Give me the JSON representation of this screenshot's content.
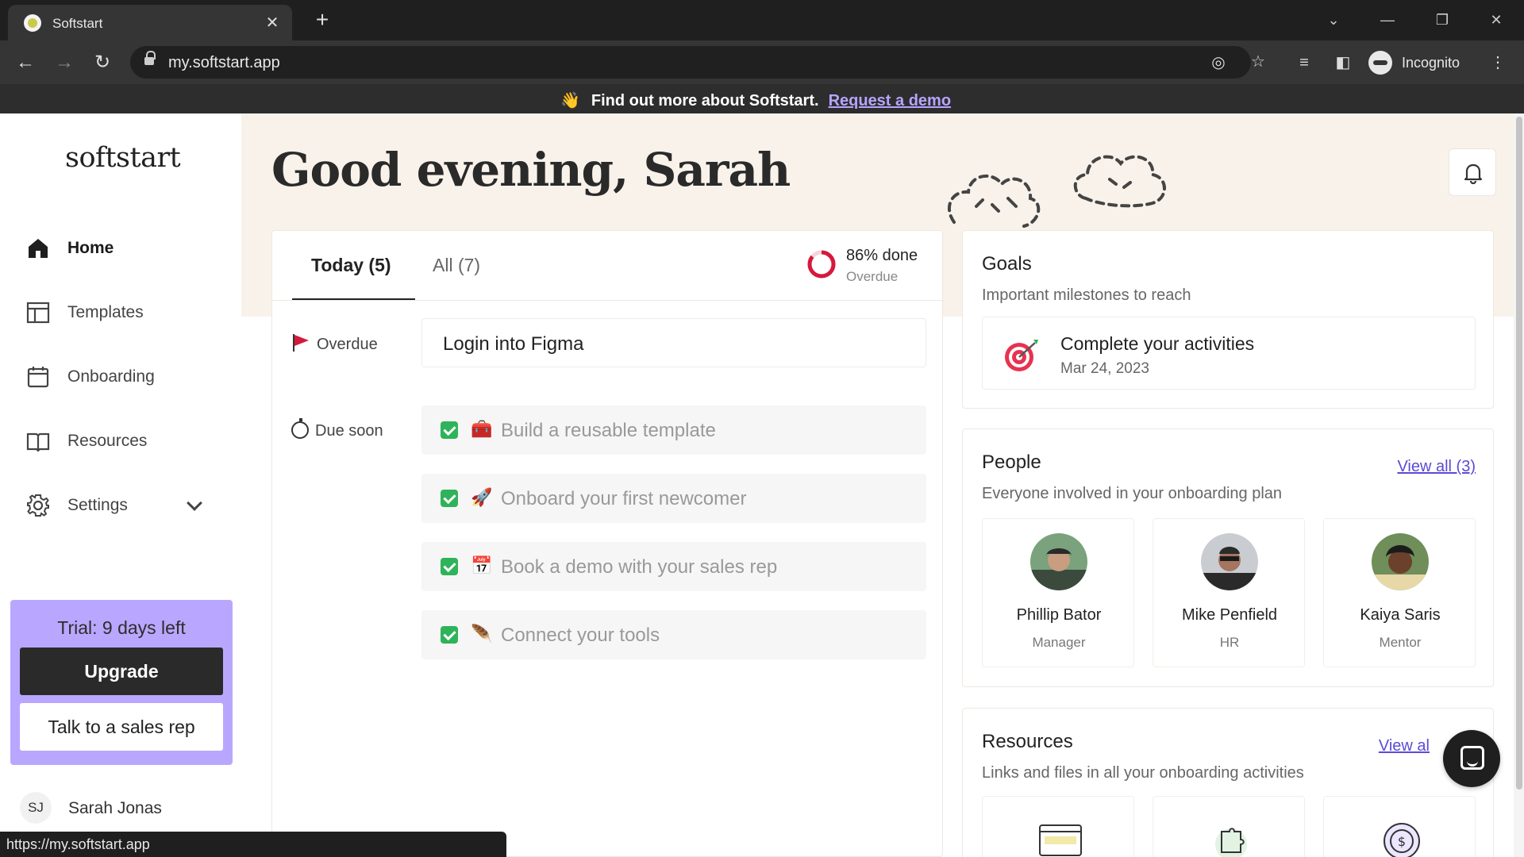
{
  "browser": {
    "tab_title": "Softstart",
    "url": "my.softstart.app",
    "profile_label": "Incognito",
    "status_url": "https://my.softstart.app"
  },
  "banner": {
    "emoji": "👋",
    "text": "Find out more about Softstart.",
    "link": "Request a demo"
  },
  "sidebar": {
    "logo": "softstart",
    "items": [
      {
        "label": "Home",
        "icon": "home-icon",
        "active": true
      },
      {
        "label": "Templates",
        "icon": "templates-icon"
      },
      {
        "label": "Onboarding",
        "icon": "calendar-icon"
      },
      {
        "label": "Resources",
        "icon": "book-icon"
      },
      {
        "label": "Settings",
        "icon": "gear-icon"
      }
    ],
    "trial": {
      "text": "Trial: 9 days left",
      "upgrade_label": "Upgrade",
      "sales_label": "Talk to a sales rep"
    },
    "user": {
      "initials": "SJ",
      "name": "Sarah Jonas"
    }
  },
  "main": {
    "greeting": "Good evening, Sarah",
    "tasks": {
      "tab_today": "Today (5)",
      "tab_all": "All (7)",
      "progress_text": "86% done",
      "progress_value": 0.86,
      "progress_sub": "Overdue",
      "overdue_label": "Overdue",
      "due_soon_label": "Due soon",
      "overdue_items": [
        {
          "title": "Login into Figma"
        }
      ],
      "due_soon_items": [
        {
          "emoji": "🧰",
          "title": "Build a reusable template",
          "done": true
        },
        {
          "emoji": "🚀",
          "title": "Onboard your first newcomer",
          "done": true
        },
        {
          "emoji": "📅",
          "title": "Book a demo with your sales rep",
          "done": true
        },
        {
          "emoji": "🪶",
          "title": "Connect your tools",
          "done": true
        }
      ]
    },
    "goals": {
      "title": "Goals",
      "subtitle": "Important milestones to reach",
      "items": [
        {
          "title": "Complete your activities",
          "date": "Mar 24, 2023",
          "icon": "target-icon"
        }
      ]
    },
    "people": {
      "title": "People",
      "subtitle": "Everyone involved in your onboarding plan",
      "view_all": "View all (3)",
      "items": [
        {
          "name": "Phillip Bator",
          "role": "Manager"
        },
        {
          "name": "Mike Penfield",
          "role": "HR"
        },
        {
          "name": "Kaiya Saris",
          "role": "Mentor"
        }
      ]
    },
    "resources": {
      "title": "Resources",
      "subtitle": "Links and files in all your onboarding activities",
      "view_all": "View al",
      "items": [
        {
          "icon": "website-icon"
        },
        {
          "icon": "puzzle-icon"
        },
        {
          "icon": "dollar-icon"
        }
      ]
    }
  },
  "colors": {
    "accent_purple": "#b9a7ff",
    "link_purple": "#5b4ad6",
    "progress_red": "#d6183c",
    "check_green": "#2fb35a"
  }
}
